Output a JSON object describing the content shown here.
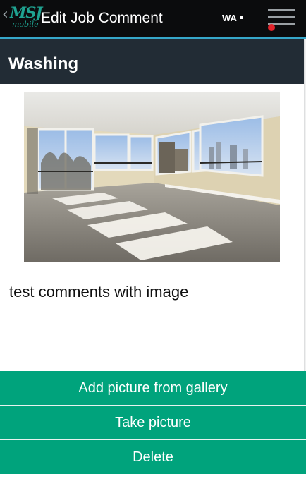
{
  "header": {
    "back_glyph": "‹",
    "logo_main": "MSJ",
    "logo_sub": "mobile",
    "title": "Edit Job Comment",
    "state_label": "WA",
    "menu_icon": "hamburger-menu-icon",
    "notification_color": "#e2232a"
  },
  "section": {
    "title": "Washing"
  },
  "photo": {
    "subject": "empty-room-with-windows-photo"
  },
  "comment": {
    "text": "test comments with image"
  },
  "actions": {
    "add_from_gallery": "Add picture from gallery",
    "take_picture": "Take picture",
    "delete": "Delete"
  },
  "colors": {
    "action_bar": "#0b0c0d",
    "action_bar_accent": "#36a7c9",
    "section_header": "#222c35",
    "button": "#00a37c",
    "logo": "#1fa391"
  }
}
